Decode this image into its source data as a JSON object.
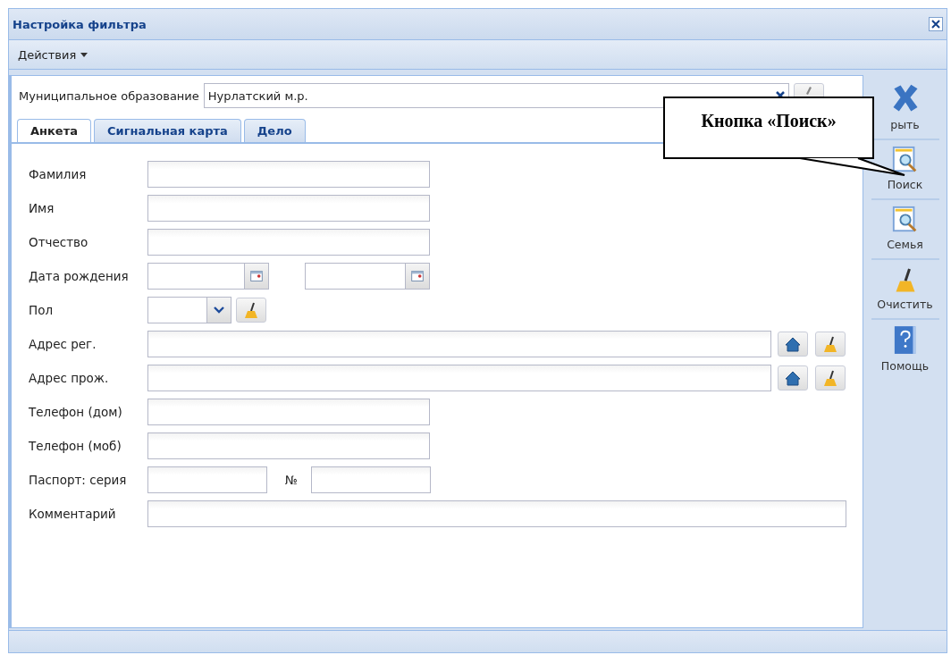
{
  "window": {
    "title": "Настройка фильтра"
  },
  "toolbar": {
    "menu": "Действия"
  },
  "municipality": {
    "label": "Муниципальное образование",
    "value": "Нурлатский м.р."
  },
  "tabs": [
    {
      "label": "Анкета",
      "selected": true
    },
    {
      "label": "Сигнальная карта",
      "selected": false
    },
    {
      "label": "Дело",
      "selected": false
    }
  ],
  "form": {
    "rows": [
      {
        "label": "Фамилия",
        "kind": "text"
      },
      {
        "label": "Имя",
        "kind": "text"
      },
      {
        "label": "Отчество",
        "kind": "text"
      },
      {
        "label": "Дата рождения",
        "kind": "date-range"
      },
      {
        "label": "Пол",
        "kind": "combo"
      },
      {
        "label": "Адрес рег.",
        "kind": "address"
      },
      {
        "label": "Адрес прож.",
        "kind": "address"
      },
      {
        "label": "Телефон (дом)",
        "kind": "text"
      },
      {
        "label": "Телефон (моб)",
        "kind": "text"
      },
      {
        "label": "Паспорт: серия",
        "kind": "passport",
        "number_label": "№"
      },
      {
        "label": "Комментарий",
        "kind": "wide"
      }
    ]
  },
  "sidebar": {
    "buttons": [
      {
        "label": "рыть",
        "kind": "close"
      },
      {
        "label": "Поиск",
        "kind": "search"
      },
      {
        "label": "Семья",
        "kind": "search"
      },
      {
        "label": "Очистить",
        "kind": "broom"
      },
      {
        "label": "Помощь",
        "kind": "help"
      }
    ]
  },
  "callout": {
    "text": "Кнопка «Поиск»"
  }
}
